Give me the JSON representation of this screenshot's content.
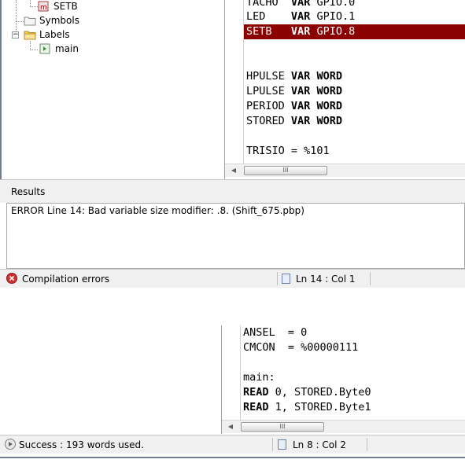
{
  "top_window": {
    "tree": {
      "items": [
        {
          "label": "SETB",
          "icon": "variable-icon"
        },
        {
          "label": "Symbols",
          "icon": "folder-icon"
        },
        {
          "label": "Labels",
          "icon": "folder-open-icon",
          "expander": "−"
        },
        {
          "label": "main",
          "icon": "label-arrow-icon"
        }
      ]
    },
    "code_lines": [
      {
        "name": "TACHO",
        "kw": "VAR",
        "type": "GPIO.0"
      },
      {
        "name": "LED",
        "kw": "VAR",
        "type": "GPIO.1"
      },
      {
        "name": "SETB",
        "kw": "VAR",
        "type": "GPIO.8",
        "highlight": true
      },
      {
        "name": "HPULSE",
        "kw": "VAR",
        "type": "WORD"
      },
      {
        "name": "LPULSE",
        "kw": "VAR",
        "type": "WORD"
      },
      {
        "name": "PERIOD",
        "kw": "VAR",
        "type": "WORD"
      },
      {
        "name": "STORED",
        "kw": "VAR",
        "type": "WORD"
      },
      {
        "text": "TRISIO = %101"
      }
    ],
    "results_title": "Results",
    "error_message": "ERROR Line 14: Bad variable size modifier: .8. (Shift_675.pbp)",
    "status_text": "Compilation errors",
    "cursor_position": "Ln 14 : Col 1",
    "status_color": "#d32f2f"
  },
  "bottom_window": {
    "code_lines": [
      {
        "text": "ANSEL  = 0"
      },
      {
        "text": "CMCON  = %00000111"
      },
      {
        "text": ""
      },
      {
        "text": "main:"
      },
      {
        "kw": "READ",
        "rest": " 0, STORED.Byte0"
      },
      {
        "kw": "READ",
        "rest": " 1, STORED.Byte1"
      }
    ],
    "status_text": "Success : 193 words used.",
    "cursor_position": "Ln 8 : Col 2"
  },
  "scrollbar_grip": "III",
  "colors": {
    "error_highlight": "#8b0000",
    "panel_bg": "#f0f0f0"
  }
}
